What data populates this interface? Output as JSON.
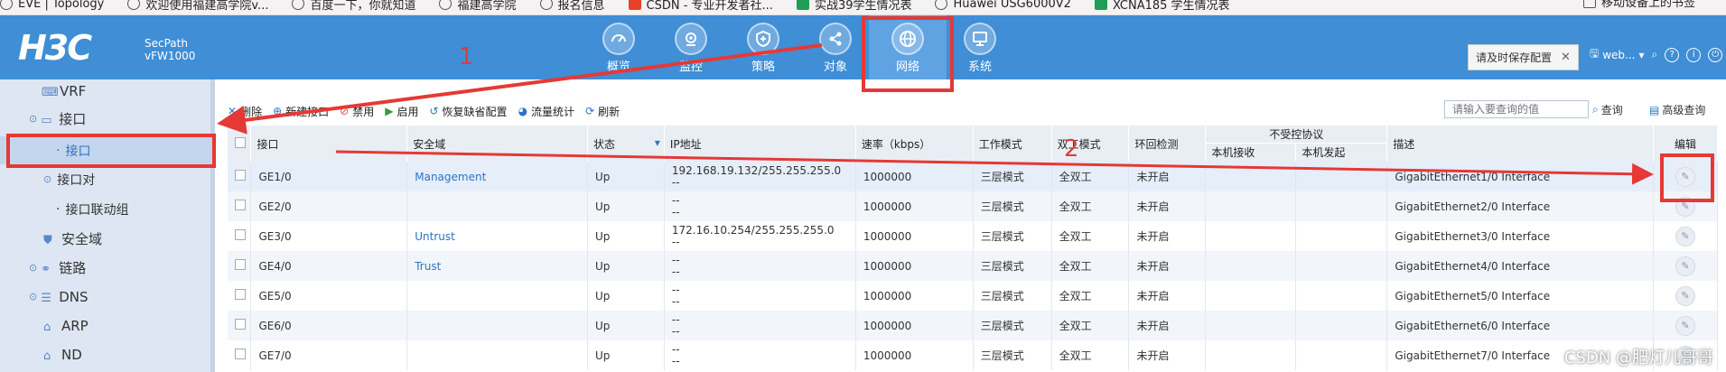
{
  "bookmarks": [
    {
      "label": "EVE | Topology",
      "icon": "globe-icon"
    },
    {
      "label": "欢迎使用福建高学院v...",
      "icon": "globe-icon"
    },
    {
      "label": "百度一下，你就知道",
      "icon": "globe-icon"
    },
    {
      "label": "福建高学院",
      "icon": "globe-icon"
    },
    {
      "label": "报名信息",
      "icon": "globe-icon"
    },
    {
      "label": "CSDN - 专业开发者社...",
      "icon": "csdn-icon"
    },
    {
      "label": "实战39学生情况表",
      "icon": "sheet-icon"
    },
    {
      "label": "Huawei USG6000V2",
      "icon": "globe-icon"
    },
    {
      "label": "XCNA185 学生情况表",
      "icon": "sheet-icon"
    }
  ],
  "bookmarks_right": "移动设备上的书签",
  "header": {
    "logo": "H3C",
    "product_line1": "SecPath",
    "product_line2": "vFW1000",
    "nav": [
      {
        "label": "概览",
        "icon": "dashboard-icon"
      },
      {
        "label": "监控",
        "icon": "monitor-icon"
      },
      {
        "label": "策略",
        "icon": "shield-icon"
      },
      {
        "label": "对象",
        "icon": "share-icon"
      },
      {
        "label": "网络",
        "icon": "globe-icon",
        "active": true
      },
      {
        "label": "系统",
        "icon": "system-icon"
      }
    ],
    "save_tip": "请及时保存配置",
    "user": "web..."
  },
  "sidebar": {
    "items": [
      {
        "label": "VRF"
      },
      {
        "label": "接口"
      },
      {
        "label": "接口"
      },
      {
        "label": "接口对"
      },
      {
        "label": "接口联动组"
      },
      {
        "label": "安全域"
      },
      {
        "label": "链路"
      },
      {
        "label": "DNS"
      },
      {
        "label": "ARP"
      },
      {
        "label": "ND"
      }
    ]
  },
  "toolbar": {
    "delete": "删除",
    "create": "新建接口",
    "disable": "禁用",
    "enable": "启用",
    "restore": "恢复缺省配置",
    "traffic": "流量统计",
    "refresh": "刷新",
    "search_placeholder": "请输入要查询的值",
    "search": "查询",
    "advanced": "高级查询"
  },
  "table": {
    "headers": {
      "interface": "接口",
      "zone": "安全域",
      "status": "状态",
      "ip": "IP地址",
      "rate": "速率（kbps）",
      "mode": "工作模式",
      "duplex": "双工模式",
      "loop": "环回检测",
      "uncontrolled": "不受控协议",
      "local_rx": "本机接收",
      "local_tx": "本机发起",
      "desc": "描述",
      "edit": "编辑"
    },
    "rows": [
      {
        "if": "GE1/0",
        "zone": "Management",
        "status": "Up",
        "ip1": "192.168.19.132/255.255.255.0",
        "ip2": "--",
        "rate": "1000000",
        "mode": "三层模式",
        "duplex": "全双工",
        "loop": "未开启",
        "desc": "GigabitEthernet1/0 Interface"
      },
      {
        "if": "GE2/0",
        "zone": "",
        "status": "Up",
        "ip1": "--",
        "ip2": "--",
        "rate": "1000000",
        "mode": "三层模式",
        "duplex": "全双工",
        "loop": "未开启",
        "desc": "GigabitEthernet2/0 Interface"
      },
      {
        "if": "GE3/0",
        "zone": "Untrust",
        "status": "Up",
        "ip1": "172.16.10.254/255.255.255.0",
        "ip2": "--",
        "rate": "1000000",
        "mode": "三层模式",
        "duplex": "全双工",
        "loop": "未开启",
        "desc": "GigabitEthernet3/0 Interface"
      },
      {
        "if": "GE4/0",
        "zone": "Trust",
        "status": "Up",
        "ip1": "--",
        "ip2": "--",
        "rate": "1000000",
        "mode": "三层模式",
        "duplex": "全双工",
        "loop": "未开启",
        "desc": "GigabitEthernet4/0 Interface"
      },
      {
        "if": "GE5/0",
        "zone": "",
        "status": "Up",
        "ip1": "--",
        "ip2": "--",
        "rate": "1000000",
        "mode": "三层模式",
        "duplex": "全双工",
        "loop": "未开启",
        "desc": "GigabitEthernet5/0 Interface"
      },
      {
        "if": "GE6/0",
        "zone": "",
        "status": "Up",
        "ip1": "--",
        "ip2": "--",
        "rate": "1000000",
        "mode": "三层模式",
        "duplex": "全双工",
        "loop": "未开启",
        "desc": "GigabitEthernet6/0 Interface"
      },
      {
        "if": "GE7/0",
        "zone": "",
        "status": "Up",
        "ip1": "--",
        "ip2": "--",
        "rate": "1000000",
        "mode": "三层模式",
        "duplex": "全双工",
        "loop": "未开启",
        "desc": "GigabitEthernet7/0 Interface"
      }
    ]
  },
  "annotations": {
    "num1": "1",
    "num2": "2",
    "color": "#e53935"
  },
  "watermark": "CSDN @肥灯儿哥哥",
  "colors": {
    "header": "#3f8ed6",
    "nav_active": "#5fa3e3",
    "sidebar": "#dde6f2",
    "link": "#2d73c5"
  }
}
